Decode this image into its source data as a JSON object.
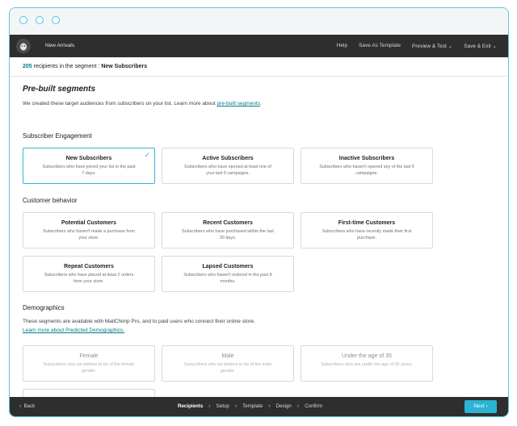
{
  "nav": {
    "title": "New Arrivals",
    "help": "Help",
    "save_template": "Save As Template",
    "preview": "Preview & Test",
    "save_exit": "Save & Exit",
    "chevron": "⌄"
  },
  "subbar": {
    "count": "205",
    "text": "recipients in the segment :",
    "segment": "New Subscribers"
  },
  "prebuilt": {
    "heading": "Pre-built segments",
    "intro": "We created these target audiences from subscribers on your list. Learn more about",
    "intro_link": "pre-built segments",
    "intro_end": "."
  },
  "engagement": {
    "heading": "Subscriber Engagement",
    "cards": [
      {
        "title": "New Subscribers",
        "desc": "Subscribers who have joined your list in the past 7 days."
      },
      {
        "title": "Active Subscribers",
        "desc": "Subscribers who have opened at least one of your last 5 campaigns."
      },
      {
        "title": "Inactive Subscribers",
        "desc": "Subscribers who haven't opened any of the last 5 campaigns."
      }
    ]
  },
  "behavior": {
    "heading": "Customer behavior",
    "cards": [
      {
        "title": "Potential Customers",
        "desc": "Subscribers who haven't made a purchase from your store."
      },
      {
        "title": "Recent Customers",
        "desc": "Subscribers who have purchased within the last 30 days."
      },
      {
        "title": "First-time Customers",
        "desc": "Subscribers who have recently made their first purchase."
      },
      {
        "title": "Repeat Customers",
        "desc": "Subscribers who have placed at least 2 orders from your store."
      },
      {
        "title": "Lapsed Customers",
        "desc": "Subscribers who haven't ordered in the past 8 months."
      }
    ]
  },
  "demographics": {
    "heading": "Demographics",
    "text": "These segments are available with MailChimp Pro, and to paid users who connect their online store.",
    "link": "Learn more about Predicted Demographics.",
    "cards": [
      {
        "title": "Female",
        "desc": "Subscribers who we believe to be of the female gender."
      },
      {
        "title": "Male",
        "desc": "Subscribers who we believe to be of the male gender."
      },
      {
        "title": "Under the age of 35",
        "desc": "Subscribers who are under the age of 35 years."
      }
    ]
  },
  "footer": {
    "back": "Back",
    "steps": [
      "Recipients",
      "Setup",
      "Template",
      "Design",
      "Confirm"
    ],
    "next": "Next",
    "chev_left": "‹",
    "chev_right": "›"
  },
  "colors": {
    "accent": "#2bb3d3",
    "link": "#007c89",
    "dark_bar": "#2e2e2e"
  }
}
